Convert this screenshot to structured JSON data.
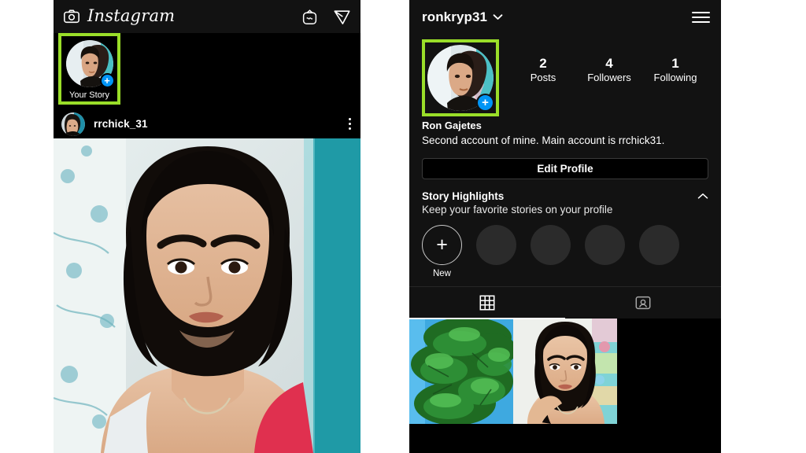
{
  "feed": {
    "topbar": {
      "camera_icon": "camera-icon",
      "wordmark": "Instagram",
      "igtv_icon": "igtv-icon",
      "direct_icon": "direct-message-icon"
    },
    "story": {
      "label": "Your Story",
      "add_badge": "+",
      "highlight_color": "#9ade29"
    },
    "post": {
      "username": "rrchick_31",
      "more_icon": "more-options-icon"
    }
  },
  "profile": {
    "topbar": {
      "username": "ronkryp31",
      "chevron_icon": "chevron-down-icon",
      "menu_icon": "hamburger-menu-icon"
    },
    "avatar": {
      "add_badge": "+",
      "highlight_color": "#9ade29"
    },
    "stats": [
      {
        "value": "2",
        "label": "Posts"
      },
      {
        "value": "4",
        "label": "Followers"
      },
      {
        "value": "1",
        "label": "Following"
      }
    ],
    "name": "Ron Gajetes",
    "bio": "Second account of mine. Main account is rrchick31.",
    "edit_profile_label": "Edit Profile",
    "highlights": {
      "title": "Story Highlights",
      "subtitle": "Keep your favorite stories on your profile",
      "collapse_icon": "chevron-up-icon",
      "new_plus": "+",
      "new_label": "New",
      "placeholder_count": 4
    },
    "tabs": [
      {
        "name": "grid-tab",
        "icon": "grid-icon",
        "active": true
      },
      {
        "name": "tagged-tab",
        "icon": "tagged-person-icon",
        "active": false
      }
    ],
    "posts": [
      {
        "name": "post-thumbnail-tree"
      },
      {
        "name": "post-thumbnail-selfie"
      }
    ]
  },
  "colors": {
    "accent_blue": "#0095f6",
    "highlight_green": "#9ade29",
    "panel_bg": "#121212",
    "black": "#000000"
  }
}
